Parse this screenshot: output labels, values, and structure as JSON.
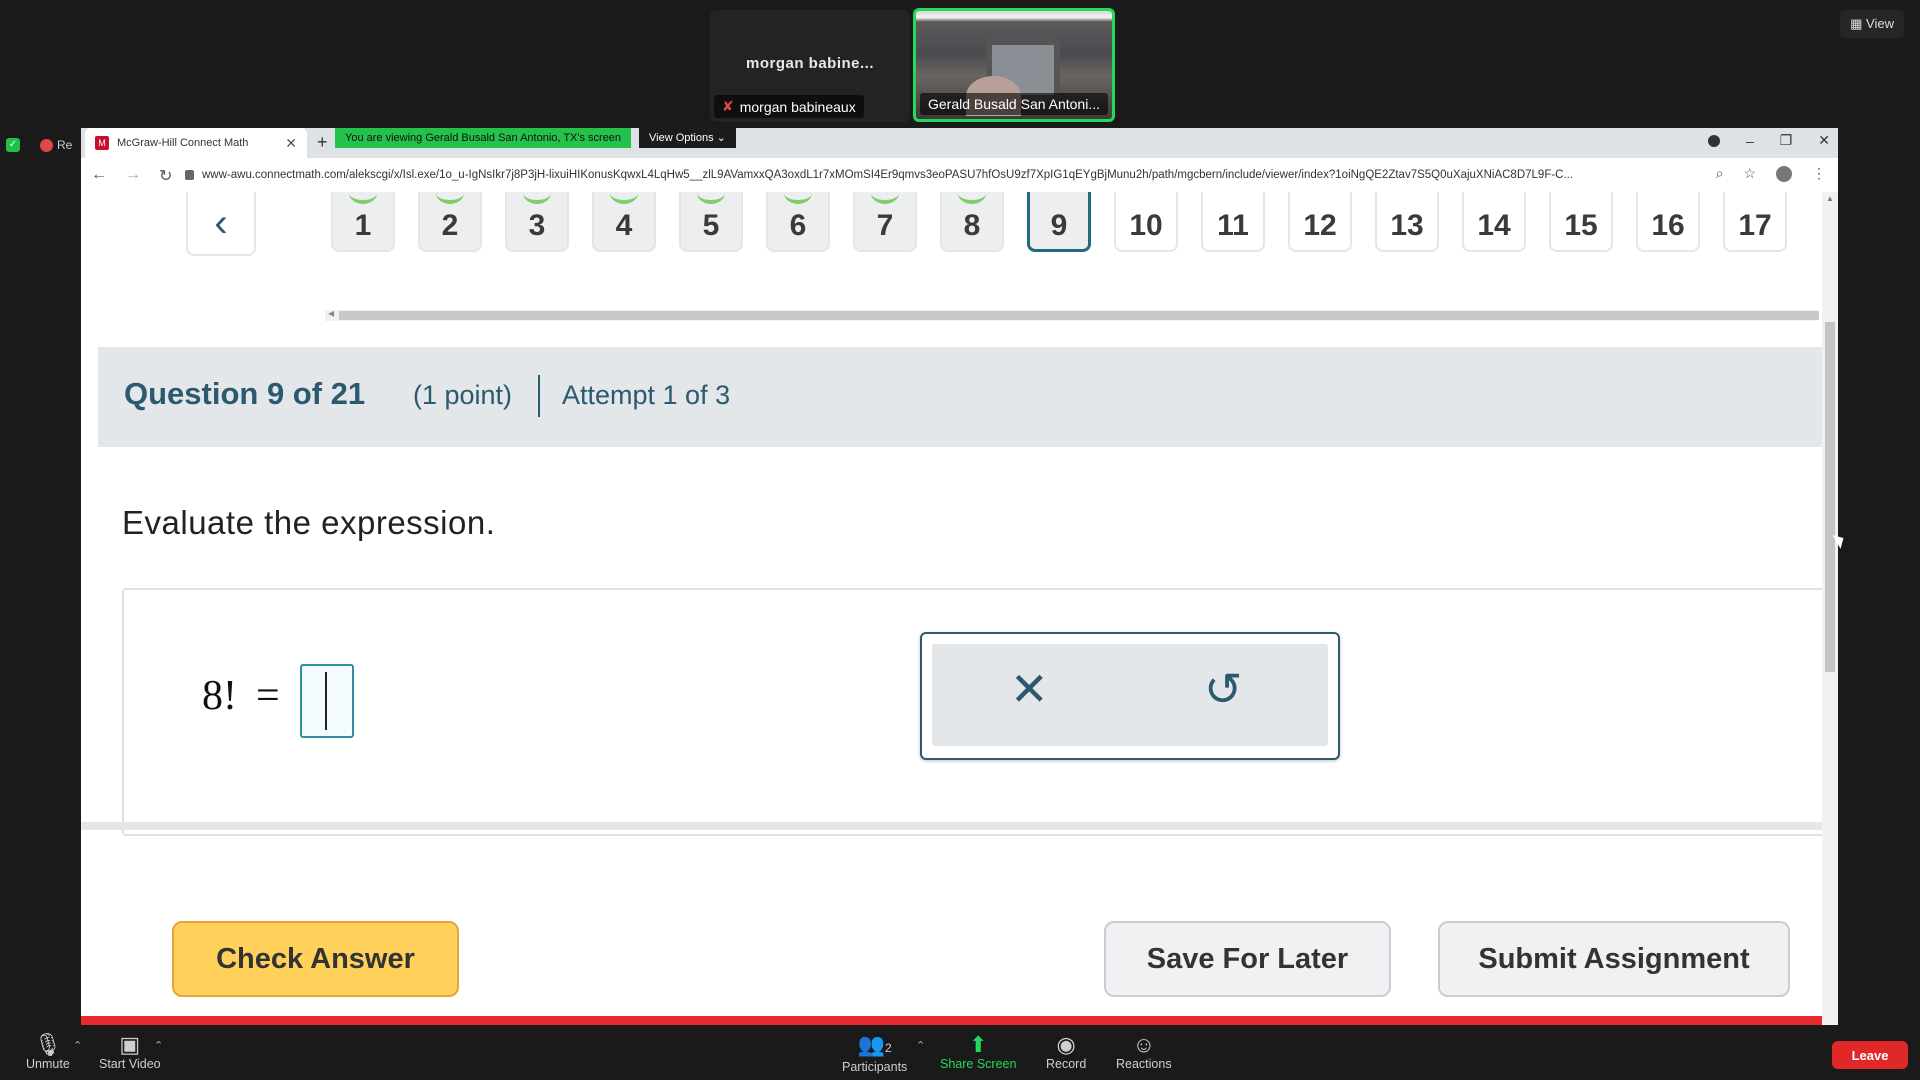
{
  "zoom": {
    "tile1_name": "morgan babine...",
    "tile1_label": "morgan babineaux",
    "tile2_label": "Gerald Busald San Antoni...",
    "view_label": "View",
    "rec_text": "Re",
    "toolbar": {
      "unmute": "Unmute",
      "start_video": "Start Video",
      "participants": "Participants",
      "participants_count": "2",
      "share_screen": "Share Screen",
      "record": "Record",
      "reactions": "Reactions",
      "leave": "Leave"
    }
  },
  "browser": {
    "tab_title": "McGraw-Hill Connect Math",
    "share_banner": "You are viewing Gerald Busald San Antonio, TX's screen",
    "view_options": "View Options",
    "url": "www-awu.connectmath.com/alekscgi/x/Isl.exe/1o_u-IgNsIkr7j8P3jH-lixuiHIKonusKqwxL4LqHw5__zlL9AVamxxQA3oxdL1r7xMOmSI4Er9qmvs3eoPASU7hfOsU9zf7XpIG1qEYgBjMunu2h/path/mgcbern/include/viewer/index?1oiNgQE2Ztav7S5Q0uXajuXNiAC8D7L9F-C..."
  },
  "question_nav": {
    "numbers": [
      "1",
      "2",
      "3",
      "4",
      "5",
      "6",
      "7",
      "8",
      "9",
      "10",
      "11",
      "12",
      "13",
      "14",
      "15",
      "16",
      "17"
    ],
    "completed_count": 8,
    "current": "9"
  },
  "question": {
    "title": "Question 9 of 21",
    "points": "(1 point)",
    "attempt": "Attempt 1 of 3",
    "prompt": "Evaluate the expression.",
    "expression": "8!",
    "equals": "=",
    "answer_value": ""
  },
  "buttons": {
    "check_answer": "Check Answer",
    "save_for_later": "Save For Later",
    "submit_assignment": "Submit Assignment"
  },
  "colors": {
    "accent": "#2b5a6e",
    "check_button": "#ffd15a",
    "zoom_green": "#23d959",
    "leave_red": "#e02828"
  }
}
